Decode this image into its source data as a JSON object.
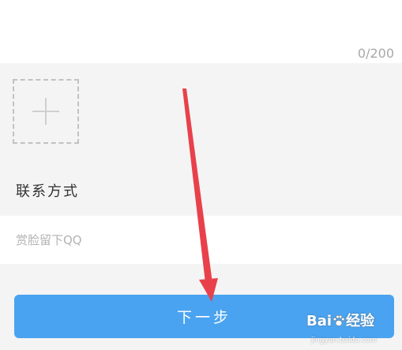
{
  "feedback": {
    "char_counter": "0/200"
  },
  "contact": {
    "title": "联系方式",
    "placeholder": "赏脸留下QQ"
  },
  "next_button": {
    "label": "下一步",
    "color": "#4aa3f0"
  },
  "annotation": {
    "arrow_color": "#e8414b"
  },
  "watermark": {
    "logo_text_1": "Bai",
    "logo_text_2": "经验",
    "url": "jingyan.baidu.com"
  }
}
